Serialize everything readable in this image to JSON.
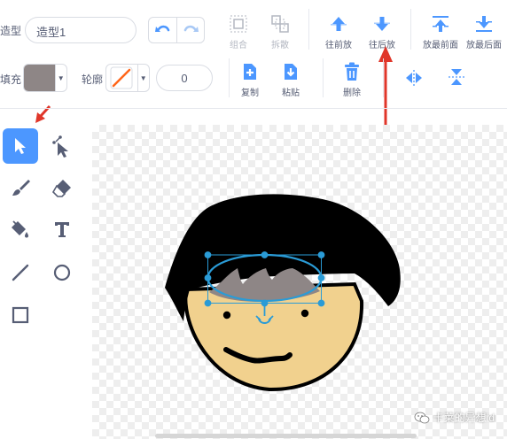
{
  "toolbar": {
    "costume_label": "造型",
    "costume_name": "造型1",
    "group_label": "组合",
    "ungroup_label": "拆散",
    "forward_label": "往前放",
    "backward_label": "往后放",
    "front_label": "放最前面",
    "back_label": "放最后面",
    "fill_label": "填充",
    "outline_label": "轮廓",
    "outline_width": "0",
    "copy_label": "复制",
    "paste_label": "粘贴",
    "delete_label": "删除"
  },
  "colors": {
    "accent": "#4c97ff",
    "fill_color": "#8e8686",
    "outline_none_slash": "#ff661a",
    "annotation_arrow": "#e0362a",
    "hair": "#000000",
    "skin": "#f1d18e",
    "selection": "#2a9bd6"
  },
  "tools": [
    "select",
    "reshape",
    "brush",
    "eraser",
    "fill",
    "text",
    "line",
    "circle",
    "rectangle"
  ],
  "watermark": {
    "text": "卡莱的异想id",
    "icon": "wechat-icon"
  }
}
